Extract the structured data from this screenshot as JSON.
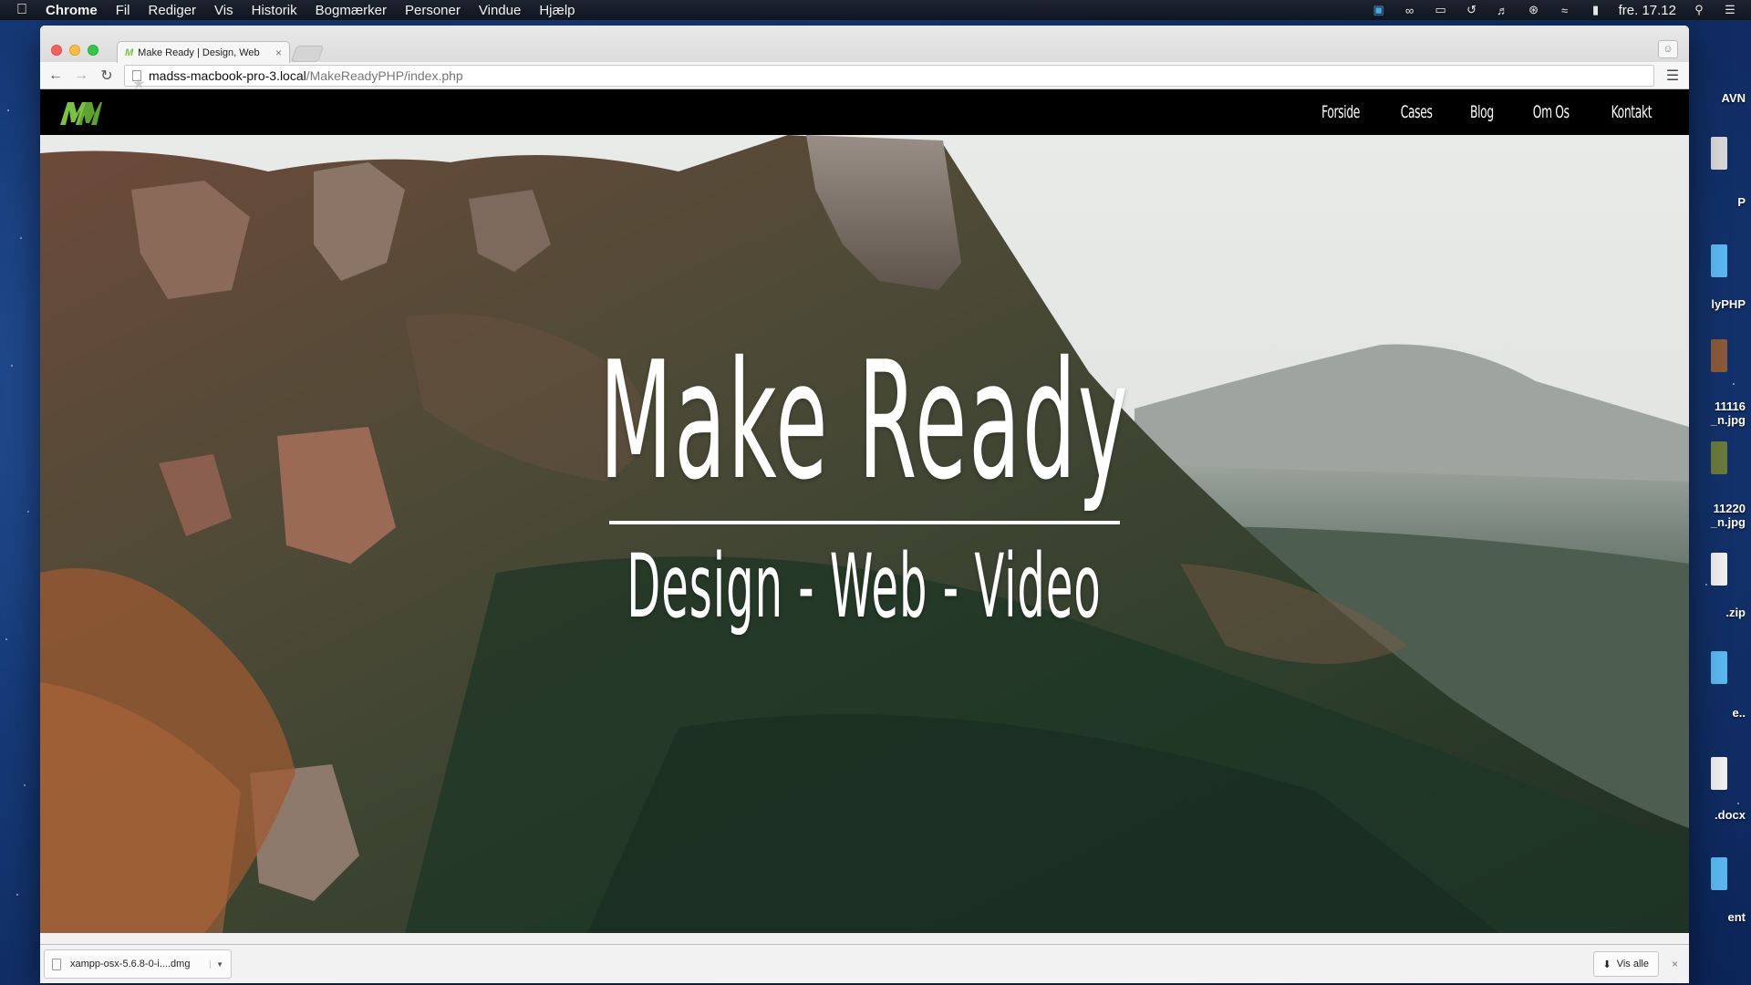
{
  "menubar": {
    "apple": "",
    "app_name": "Chrome",
    "items": [
      "Fil",
      "Rediger",
      "Vis",
      "Historik",
      "Bogmærker",
      "Personer",
      "Vindue",
      "Hjælp"
    ],
    "clock": "fre. 17.12",
    "tray_icons": [
      "skype-icon",
      "creative-cloud-icon",
      "airplay-icon",
      "time-machine-icon",
      "volume-icon",
      "bluetooth-icon",
      "wifi-icon",
      "battery-icon",
      "spotlight-icon",
      "notification-center-icon"
    ]
  },
  "desktop": {
    "labels": [
      "AVN",
      "P",
      "lyPHP",
      "11116\n_n.jpg",
      "11220\n_n.jpg",
      ".zip",
      "e..",
      ".docx",
      "ent"
    ]
  },
  "browser": {
    "tab": {
      "title": "Make Ready | Design, Web",
      "favicon": "M"
    },
    "url": {
      "host": "madss-macbook-pro-3.local",
      "path": "/MakeReadyPHP/index.php"
    }
  },
  "site": {
    "nav": [
      "Forside",
      "Cases",
      "Blog",
      "Om Os",
      "Kontakt"
    ],
    "hero": {
      "title": "Make Ready",
      "subtitle": "Design - Web - Video"
    },
    "colors": {
      "logo": "#7bc142",
      "nav_bg": "#000000",
      "nav_text": "#ffffff"
    }
  },
  "downloads": {
    "item": "xampp-osx-5.6.8-0-i....dmg",
    "show_all": "Vis alle"
  }
}
